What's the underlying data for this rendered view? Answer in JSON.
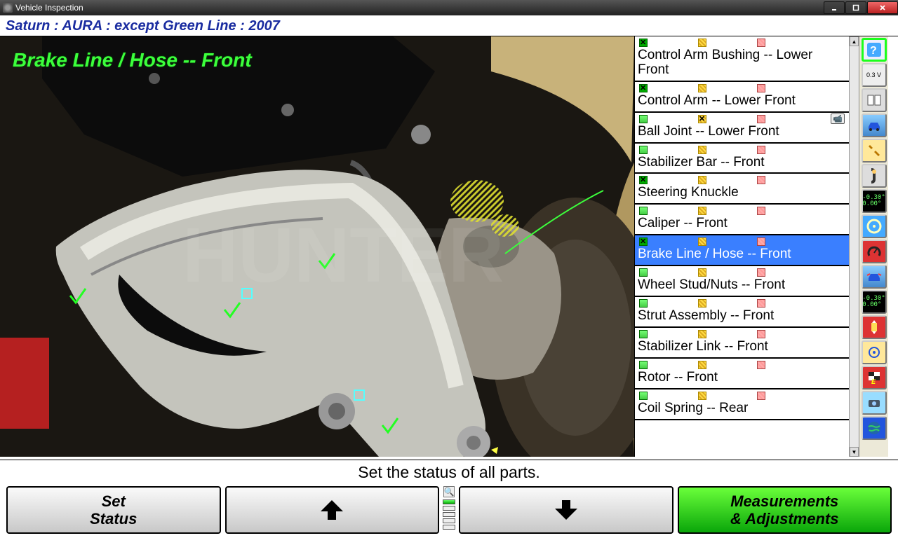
{
  "window": {
    "title": "Vehicle Inspection"
  },
  "vehicle_header": "Saturn : AURA : except Green Line : 2007",
  "photo_label": "Brake Line / Hose -- Front",
  "parts": [
    {
      "label": "Control Arm Bushing -- Lower Front",
      "status": "green-checked",
      "selected": false
    },
    {
      "label": "Control Arm -- Lower Front",
      "status": "green-checked",
      "selected": false
    },
    {
      "label": "Ball Joint -- Lower Front",
      "status": "yellow-checked",
      "selected": false,
      "video": true
    },
    {
      "label": "Stabilizer Bar -- Front",
      "status": "none",
      "selected": false
    },
    {
      "label": "Steering Knuckle",
      "status": "green-checked",
      "selected": false
    },
    {
      "label": "Caliper -- Front",
      "status": "none",
      "selected": false
    },
    {
      "label": "Brake Line / Hose -- Front",
      "status": "green-checked",
      "selected": true
    },
    {
      "label": "Wheel Stud/Nuts -- Front",
      "status": "none",
      "selected": false
    },
    {
      "label": "Strut Assembly -- Front",
      "status": "none",
      "selected": false
    },
    {
      "label": "Stabilizer Link -- Front",
      "status": "none",
      "selected": false
    },
    {
      "label": "Rotor -- Front",
      "status": "none",
      "selected": false
    },
    {
      "label": "Coil Spring -- Rear",
      "status": "none",
      "selected": false
    }
  ],
  "status_text": "Set the status of all parts.",
  "buttons": {
    "set_status": "Set\nStatus",
    "measurements": "Measurements\n& Adjustments"
  },
  "toolbar": {
    "reading1": "-0.30°\n0.00°",
    "reading2": "-0.30°\n0.00°",
    "volt": "0.3 V"
  }
}
